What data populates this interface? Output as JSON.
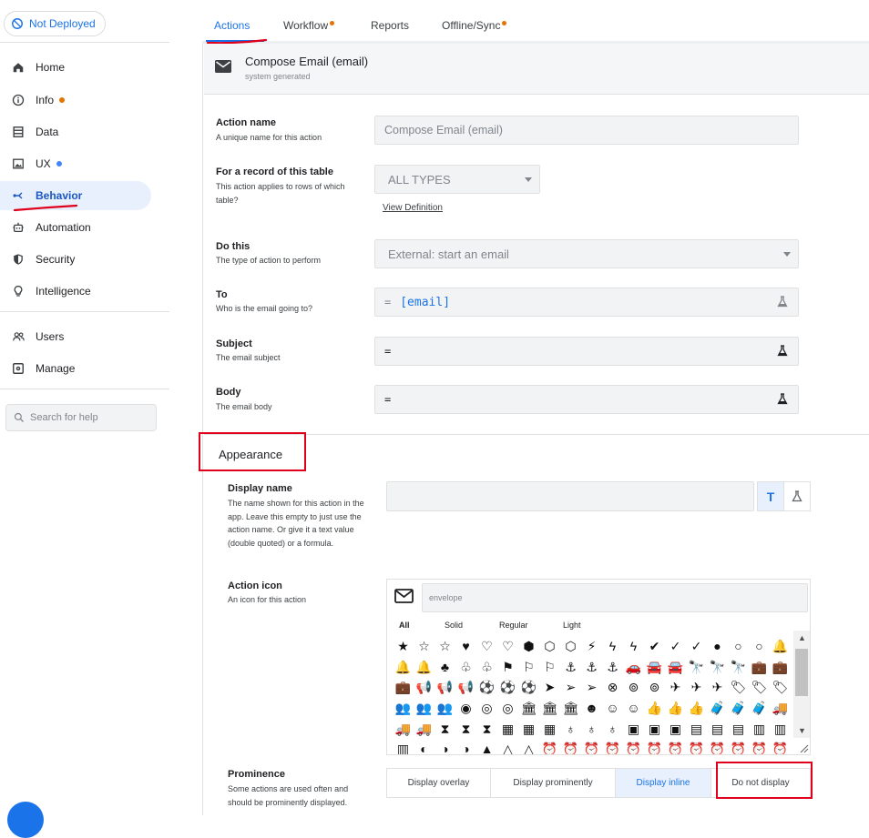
{
  "sidebar": {
    "deploy_status": "Not Deployed",
    "items": [
      {
        "label": "Home"
      },
      {
        "label": "Info"
      },
      {
        "label": "Data"
      },
      {
        "label": "UX"
      },
      {
        "label": "Behavior"
      },
      {
        "label": "Automation"
      },
      {
        "label": "Security"
      },
      {
        "label": "Intelligence"
      },
      {
        "label": "Users"
      },
      {
        "label": "Manage"
      }
    ],
    "search_placeholder": "Search for help"
  },
  "tabs": [
    {
      "label": "Actions"
    },
    {
      "label": "Workflow"
    },
    {
      "label": "Reports"
    },
    {
      "label": "Offline/Sync"
    }
  ],
  "colors": {
    "accent": "#1a73e8",
    "orange_dot": "#e37400",
    "blue_dot": "#4285f4",
    "annotation_red": "#e0001b"
  },
  "action": {
    "title": "Compose Email (email)",
    "subtitle": "system generated",
    "name": {
      "label": "Action name",
      "desc": "A unique name for this action",
      "value": "Compose Email (email)"
    },
    "table": {
      "label": "For a record of this table",
      "desc": "This action applies to rows of which table?",
      "value": "ALL TYPES",
      "link": "View Definition"
    },
    "do_this": {
      "label": "Do this",
      "desc": "The type of action to perform",
      "value": "External: start an email"
    },
    "to": {
      "label": "To",
      "desc": "Who is the email going to?",
      "eq": "=",
      "value": "[email]"
    },
    "subject": {
      "label": "Subject",
      "desc": "The email subject",
      "eq": "="
    },
    "body": {
      "label": "Body",
      "desc": "The email body",
      "eq": "="
    }
  },
  "appearance": {
    "title": "Appearance",
    "display_name": {
      "label": "Display name",
      "desc": "The name shown for this action in the app. Leave this empty to just use the action name. Or give it a text value (double quoted) or a formula.",
      "value": "",
      "text_btn": "T"
    },
    "action_icon": {
      "label": "Action icon",
      "desc": "An icon for this action",
      "search_value": "envelope",
      "filters": [
        "All",
        "Solid",
        "Regular",
        "Light"
      ],
      "icons": [
        "★",
        "☆",
        "☆",
        "♥",
        "♡",
        "♡",
        "⬢",
        "⬡",
        "⬡",
        "⚡",
        "ϟ",
        "ϟ",
        "✔",
        "✓",
        "✓",
        "●",
        "○",
        "○",
        "🔔",
        "🔔",
        "🔔",
        "♣",
        "♧",
        "♧",
        "⚑",
        "⚐",
        "⚐",
        "⚓",
        "⚓",
        "⚓",
        "🚗",
        "🚘",
        "🚘",
        "🔭",
        "🔭",
        "🔭",
        "💼",
        "💼",
        "💼",
        "📢",
        "📢",
        "📢",
        "⚽",
        "⚽",
        "⚽",
        "➤",
        "➢",
        "➢",
        "⊗",
        "⊚",
        "⊚",
        "✈",
        "✈",
        "✈",
        "🏷",
        "🏷",
        "🏷",
        "👥",
        "👥",
        "👥",
        "◉",
        "◎",
        "◎",
        "🏛",
        "🏛",
        "🏛",
        "☻",
        "☺",
        "☺",
        "👍",
        "👍",
        "👍",
        "🧳",
        "🧳",
        "🧳",
        "🚚",
        "🚚",
        "🚚",
        "⧗",
        "⧗",
        "⧗",
        "▦",
        "▦",
        "▦",
        "♁",
        "♁",
        "♁",
        "▣",
        "▣",
        "▣",
        "▤",
        "▤",
        "▤",
        "▥",
        "▥",
        "▥",
        "◐",
        "◑",
        "◑",
        "▲",
        "△",
        "△",
        "⏰",
        "⏰",
        "⏰",
        "⏰",
        "⏰",
        "⏰",
        "⏰",
        "⏰",
        "⏰",
        "⏰",
        "⏰",
        "⏰"
      ]
    },
    "prominence": {
      "label": "Prominence",
      "desc": "Some actions are used often and should be prominently displayed.",
      "options": [
        "Display overlay",
        "Display prominently",
        "Display inline",
        "Do not display"
      ],
      "selected": "Display inline"
    }
  }
}
